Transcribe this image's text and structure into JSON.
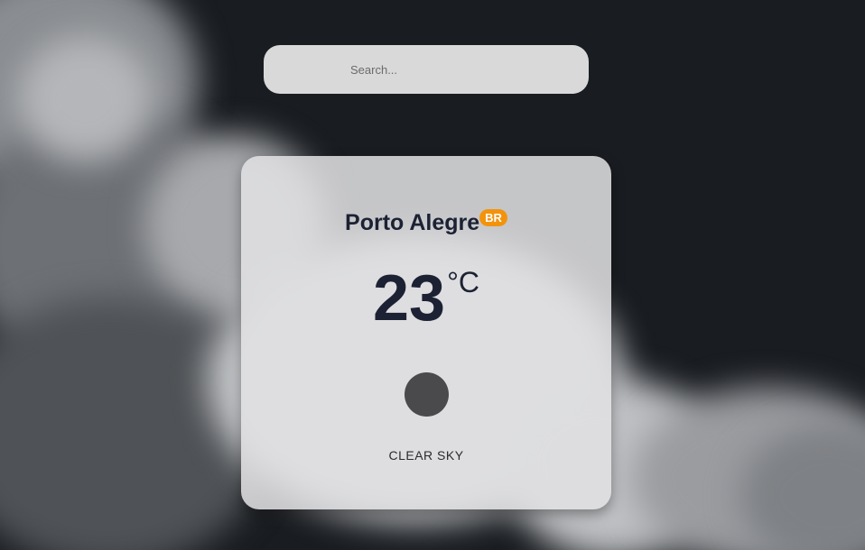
{
  "search": {
    "placeholder": "Search..."
  },
  "weather": {
    "city": "Porto Alegre",
    "country_code": "BR",
    "temperature": "23",
    "unit": "°C",
    "description": "CLEAR SKY",
    "icon": "weather-icon"
  },
  "colors": {
    "background": "#191c20",
    "card": "#e2e2e4",
    "search_bar": "#d9d9d9",
    "badge": "#f3930b",
    "text_dark": "#1c2233",
    "icon_circle": "#4a4a4c"
  }
}
